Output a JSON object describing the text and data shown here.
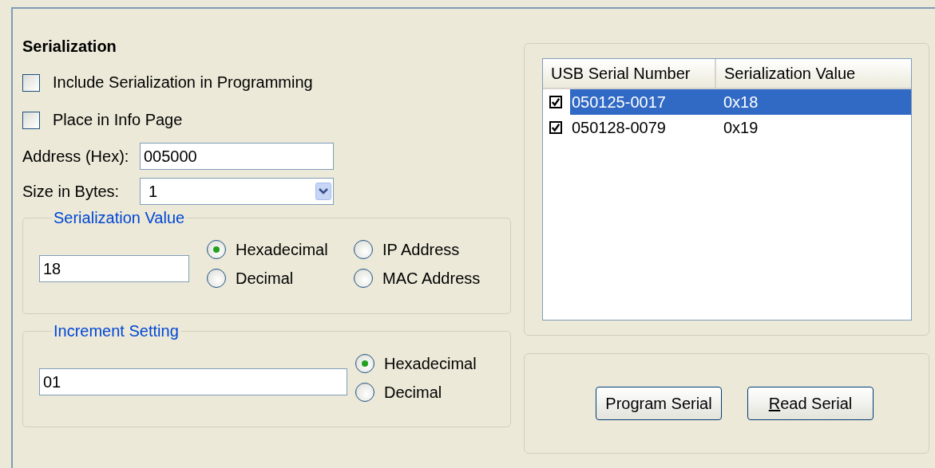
{
  "title": "Serialization",
  "options": [
    {
      "label": "Include Serialization in Programming",
      "checked": false
    },
    {
      "label": "Place in Info Page",
      "checked": false
    }
  ],
  "address": {
    "label": "Address (Hex):",
    "value": "005000"
  },
  "size": {
    "label": "Size in Bytes:",
    "value": "1"
  },
  "serialization_value": {
    "title": "Serialization Value",
    "value": "18",
    "formats": [
      {
        "label": "Hexadecimal",
        "selected": true
      },
      {
        "label": "IP Address",
        "selected": false
      },
      {
        "label": "Decimal",
        "selected": false
      },
      {
        "label": "MAC Address",
        "selected": false
      }
    ]
  },
  "increment_setting": {
    "title": "Increment Setting",
    "value": "01",
    "formats": [
      {
        "label": "Hexadecimal",
        "selected": true
      },
      {
        "label": "Decimal",
        "selected": false
      }
    ]
  },
  "table": {
    "columns": [
      "USB Serial Number",
      "Serialization Value"
    ],
    "rows": [
      {
        "serial": "050125-0017",
        "value": "0x18",
        "checked": true,
        "selected": true
      },
      {
        "serial": "050128-0079",
        "value": "0x19",
        "checked": true,
        "selected": false
      }
    ]
  },
  "buttons": [
    {
      "label": "Program Serial",
      "underline_first": false
    },
    {
      "label": "Read Serial",
      "underline_first": true
    }
  ]
}
